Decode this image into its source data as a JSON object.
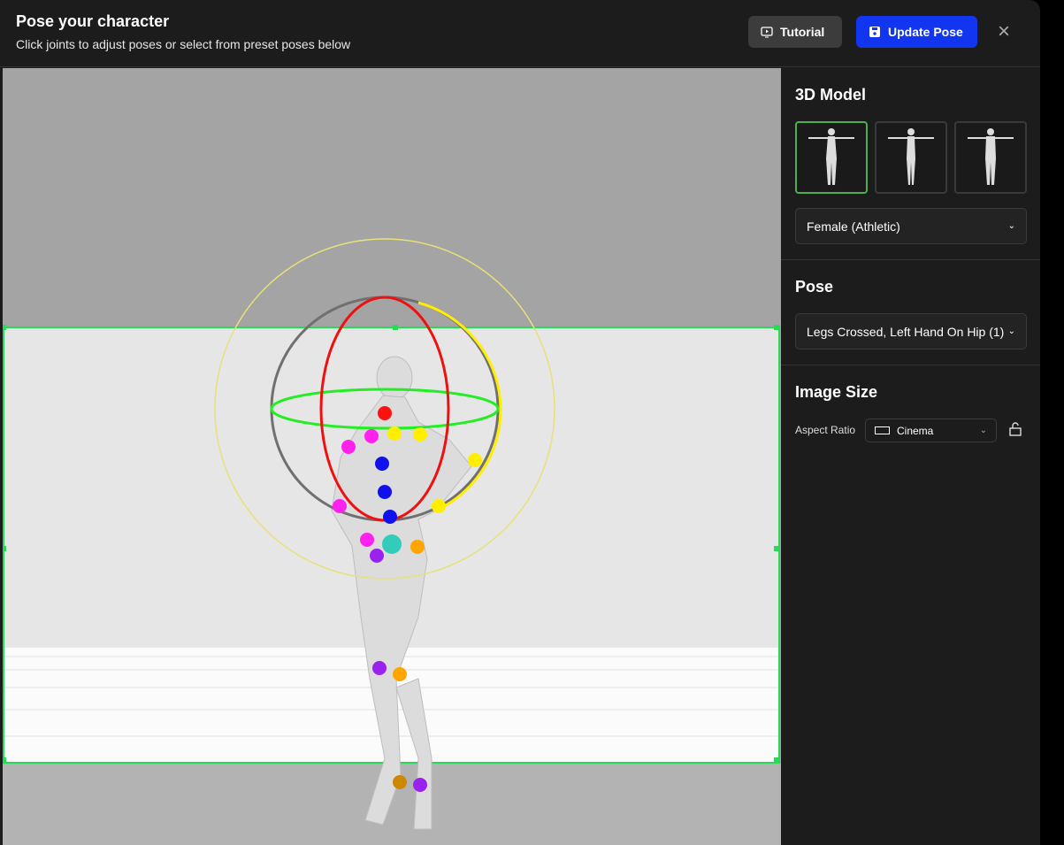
{
  "header": {
    "title": "Pose your character",
    "subtitle": "Click joints to adjust poses or select from preset poses below",
    "tutorial_label": "Tutorial",
    "update_label": "Update Pose",
    "close_icon": "×"
  },
  "panel": {
    "model_heading": "3D Model",
    "model_select": "Female (Athletic)",
    "pose_heading": "Pose",
    "pose_select": "Legs Crossed, Left Hand On Hip (1)",
    "size_heading": "Image Size",
    "aspect_label": "Aspect Ratio",
    "aspect_value": "Cinema"
  },
  "colors": {
    "accent": "#1236f0",
    "selected": "#4caf50",
    "frame": "#22dd55"
  }
}
